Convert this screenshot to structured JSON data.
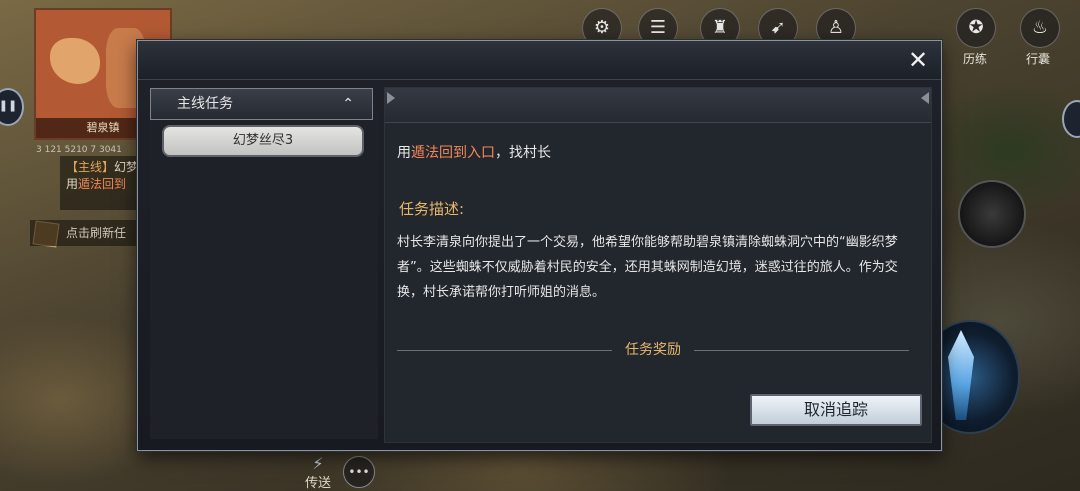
{
  "hud": {
    "minimap_location": "碧泉镇",
    "coords": "3 121 5210 7 3041",
    "side_quest_tag": "【主线】",
    "side_quest_title": "幻梦",
    "side_quest_use": "用",
    "side_quest_highlight": "遁法回到",
    "refresh_note": "点击刷新任",
    "top_labels": [
      "历练",
      "行囊"
    ],
    "teleport_label": "传送"
  },
  "dialog": {
    "close_symbol": "✕",
    "category": {
      "label": "主线任务",
      "chevron": "⌃"
    },
    "selected_quest": "幻梦丝尽3",
    "objective": {
      "prefix": "用",
      "highlight": "遁法回到入口",
      "suffix": "，找村长"
    },
    "description_title": "任务描述:",
    "description": "村长李清泉向你提出了一个交易，他希望你能够帮助碧泉镇清除蜘蛛洞穴中的“幽影织梦者”。这些蜘蛛不仅威胁着村民的安全，还用其蛛网制造幻境，迷惑过往的旅人。作为交换，村长承诺帮你打听师姐的消息。",
    "reward_title": "任务奖励",
    "untrack_button": "取消追踪"
  },
  "colors": {
    "highlight_orange": "#f4885a",
    "title_gold": "#e8b86a",
    "panel_dark": "#22262d"
  }
}
